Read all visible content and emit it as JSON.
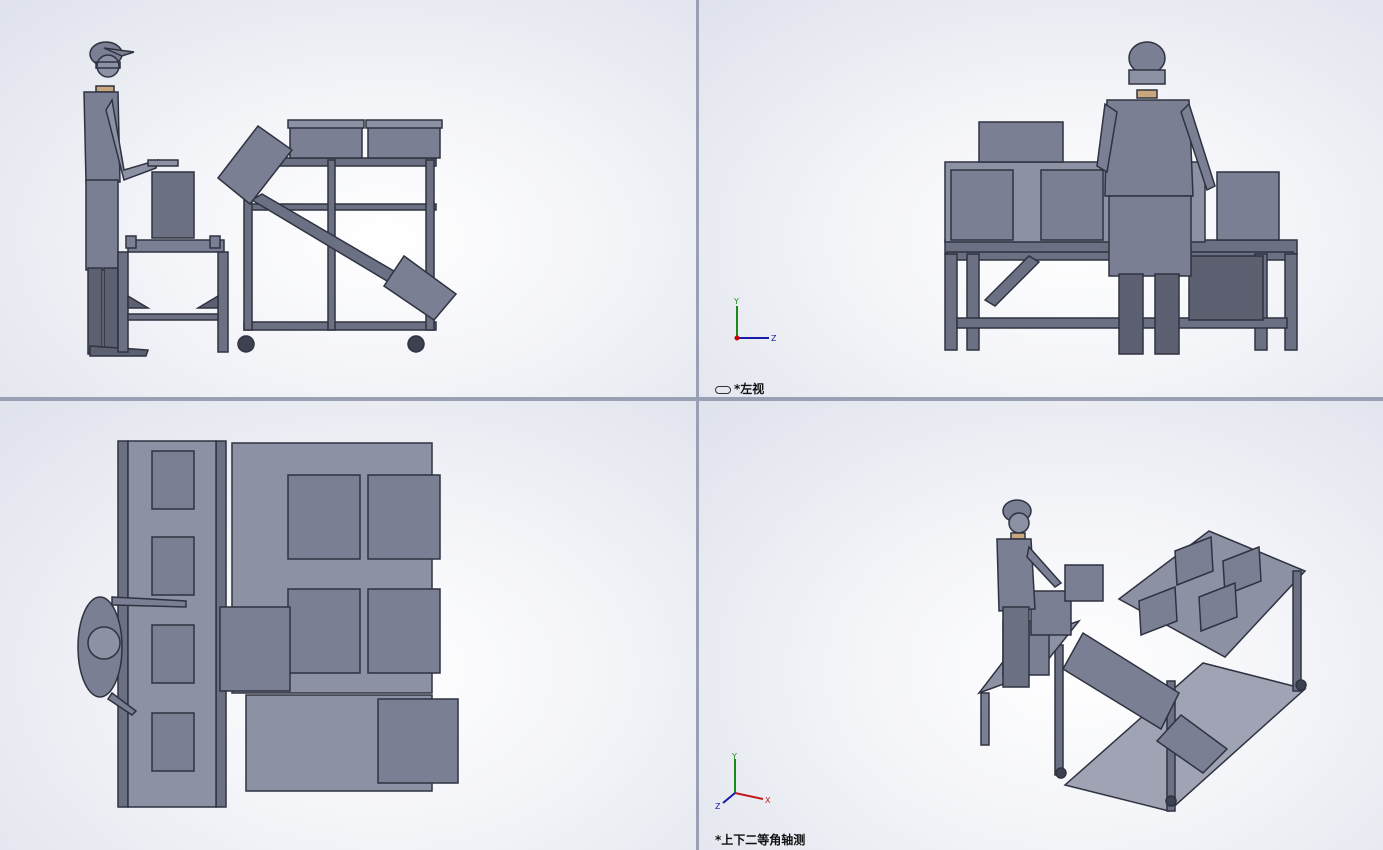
{
  "viewports": {
    "top_left": {
      "label": ""
    },
    "top_right": {
      "label": "*左视",
      "icon": "link-icon"
    },
    "bottom_left": {
      "label": ""
    },
    "bottom_right": {
      "label": "*上下二等角轴测"
    }
  },
  "triad": {
    "x": "Z",
    "y": "Y",
    "z_right": "Z",
    "z_iso": "Z",
    "x_iso": "X"
  },
  "colors": {
    "part": "#7b7f93",
    "part_dark": "#3e4150",
    "part_light": "#a4a8bb",
    "frame": "#2f3240",
    "skin": "#c9a77c",
    "separator": "#9aa0b4"
  }
}
